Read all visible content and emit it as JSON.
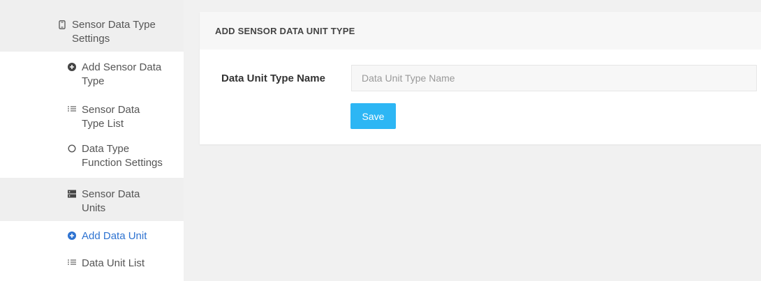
{
  "sidebar": {
    "items": [
      {
        "label": "Sensor Data Type Settings",
        "icon": "mobile-icon",
        "type": "parent"
      },
      {
        "label": "Add Sensor Data Type",
        "icon": "plus-circle-icon",
        "type": "child"
      },
      {
        "label": "Sensor Data Type List",
        "icon": "list-icon",
        "type": "child"
      },
      {
        "label": "Data Type Function Settings",
        "icon": "circle-outline-icon",
        "type": "child"
      },
      {
        "label": "Sensor Data Units",
        "icon": "server-icon",
        "type": "parent"
      },
      {
        "label": "Add Data Unit",
        "icon": "plus-circle-icon",
        "type": "child",
        "active": true
      },
      {
        "label": "Data Unit List",
        "icon": "list-icon",
        "type": "child"
      }
    ]
  },
  "card": {
    "title": "ADD SENSOR DATA UNIT TYPE",
    "field_label": "Data Unit Type Name",
    "field_placeholder": "Data Unit Type Name",
    "field_value": "",
    "save_label": "Save"
  },
  "colors": {
    "active_link": "#2e73d1",
    "button": "#2db6f4",
    "page_background": "#f1f1f1",
    "parent_item_background": "#efefef"
  }
}
